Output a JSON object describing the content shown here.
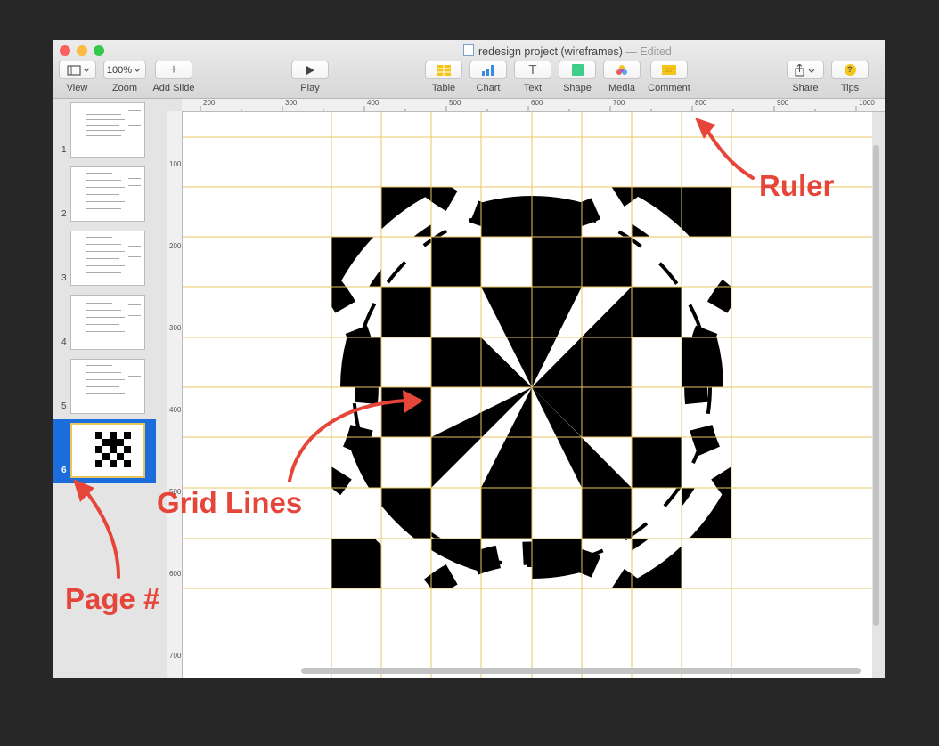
{
  "window": {
    "title": "redesign project (wireframes)",
    "title_separator": "—",
    "title_status": "Edited"
  },
  "toolbar": {
    "view": {
      "label": "View"
    },
    "zoom": {
      "label": "Zoom",
      "value": "100%"
    },
    "add_slide": {
      "label": "Add Slide",
      "glyph": "+"
    },
    "play": {
      "label": "Play"
    },
    "table": {
      "label": "Table"
    },
    "chart": {
      "label": "Chart"
    },
    "text": {
      "label": "Text",
      "glyph": "T"
    },
    "shape": {
      "label": "Shape"
    },
    "media": {
      "label": "Media"
    },
    "comment": {
      "label": "Comment"
    },
    "share": {
      "label": "Share"
    },
    "tips": {
      "label": "Tips",
      "glyph": "?"
    }
  },
  "sidebar": {
    "pages": [
      {
        "number": "1"
      },
      {
        "number": "2"
      },
      {
        "number": "3"
      },
      {
        "number": "4"
      },
      {
        "number": "5"
      },
      {
        "number": "6",
        "selected": true
      }
    ]
  },
  "ruler": {
    "horizontal": [
      "200",
      "300",
      "400",
      "500",
      "600",
      "700",
      "800",
      "900",
      "1000"
    ],
    "vertical": [
      "100",
      "200",
      "300",
      "400",
      "500",
      "600",
      "700"
    ]
  },
  "annotations": {
    "ruler": "Ruler",
    "grid_lines": "Grid Lines",
    "page_number": "Page #"
  },
  "colors": {
    "annotation": "#e6453a",
    "selection": "#1a6ddb",
    "grid_line": "#e8c566"
  }
}
